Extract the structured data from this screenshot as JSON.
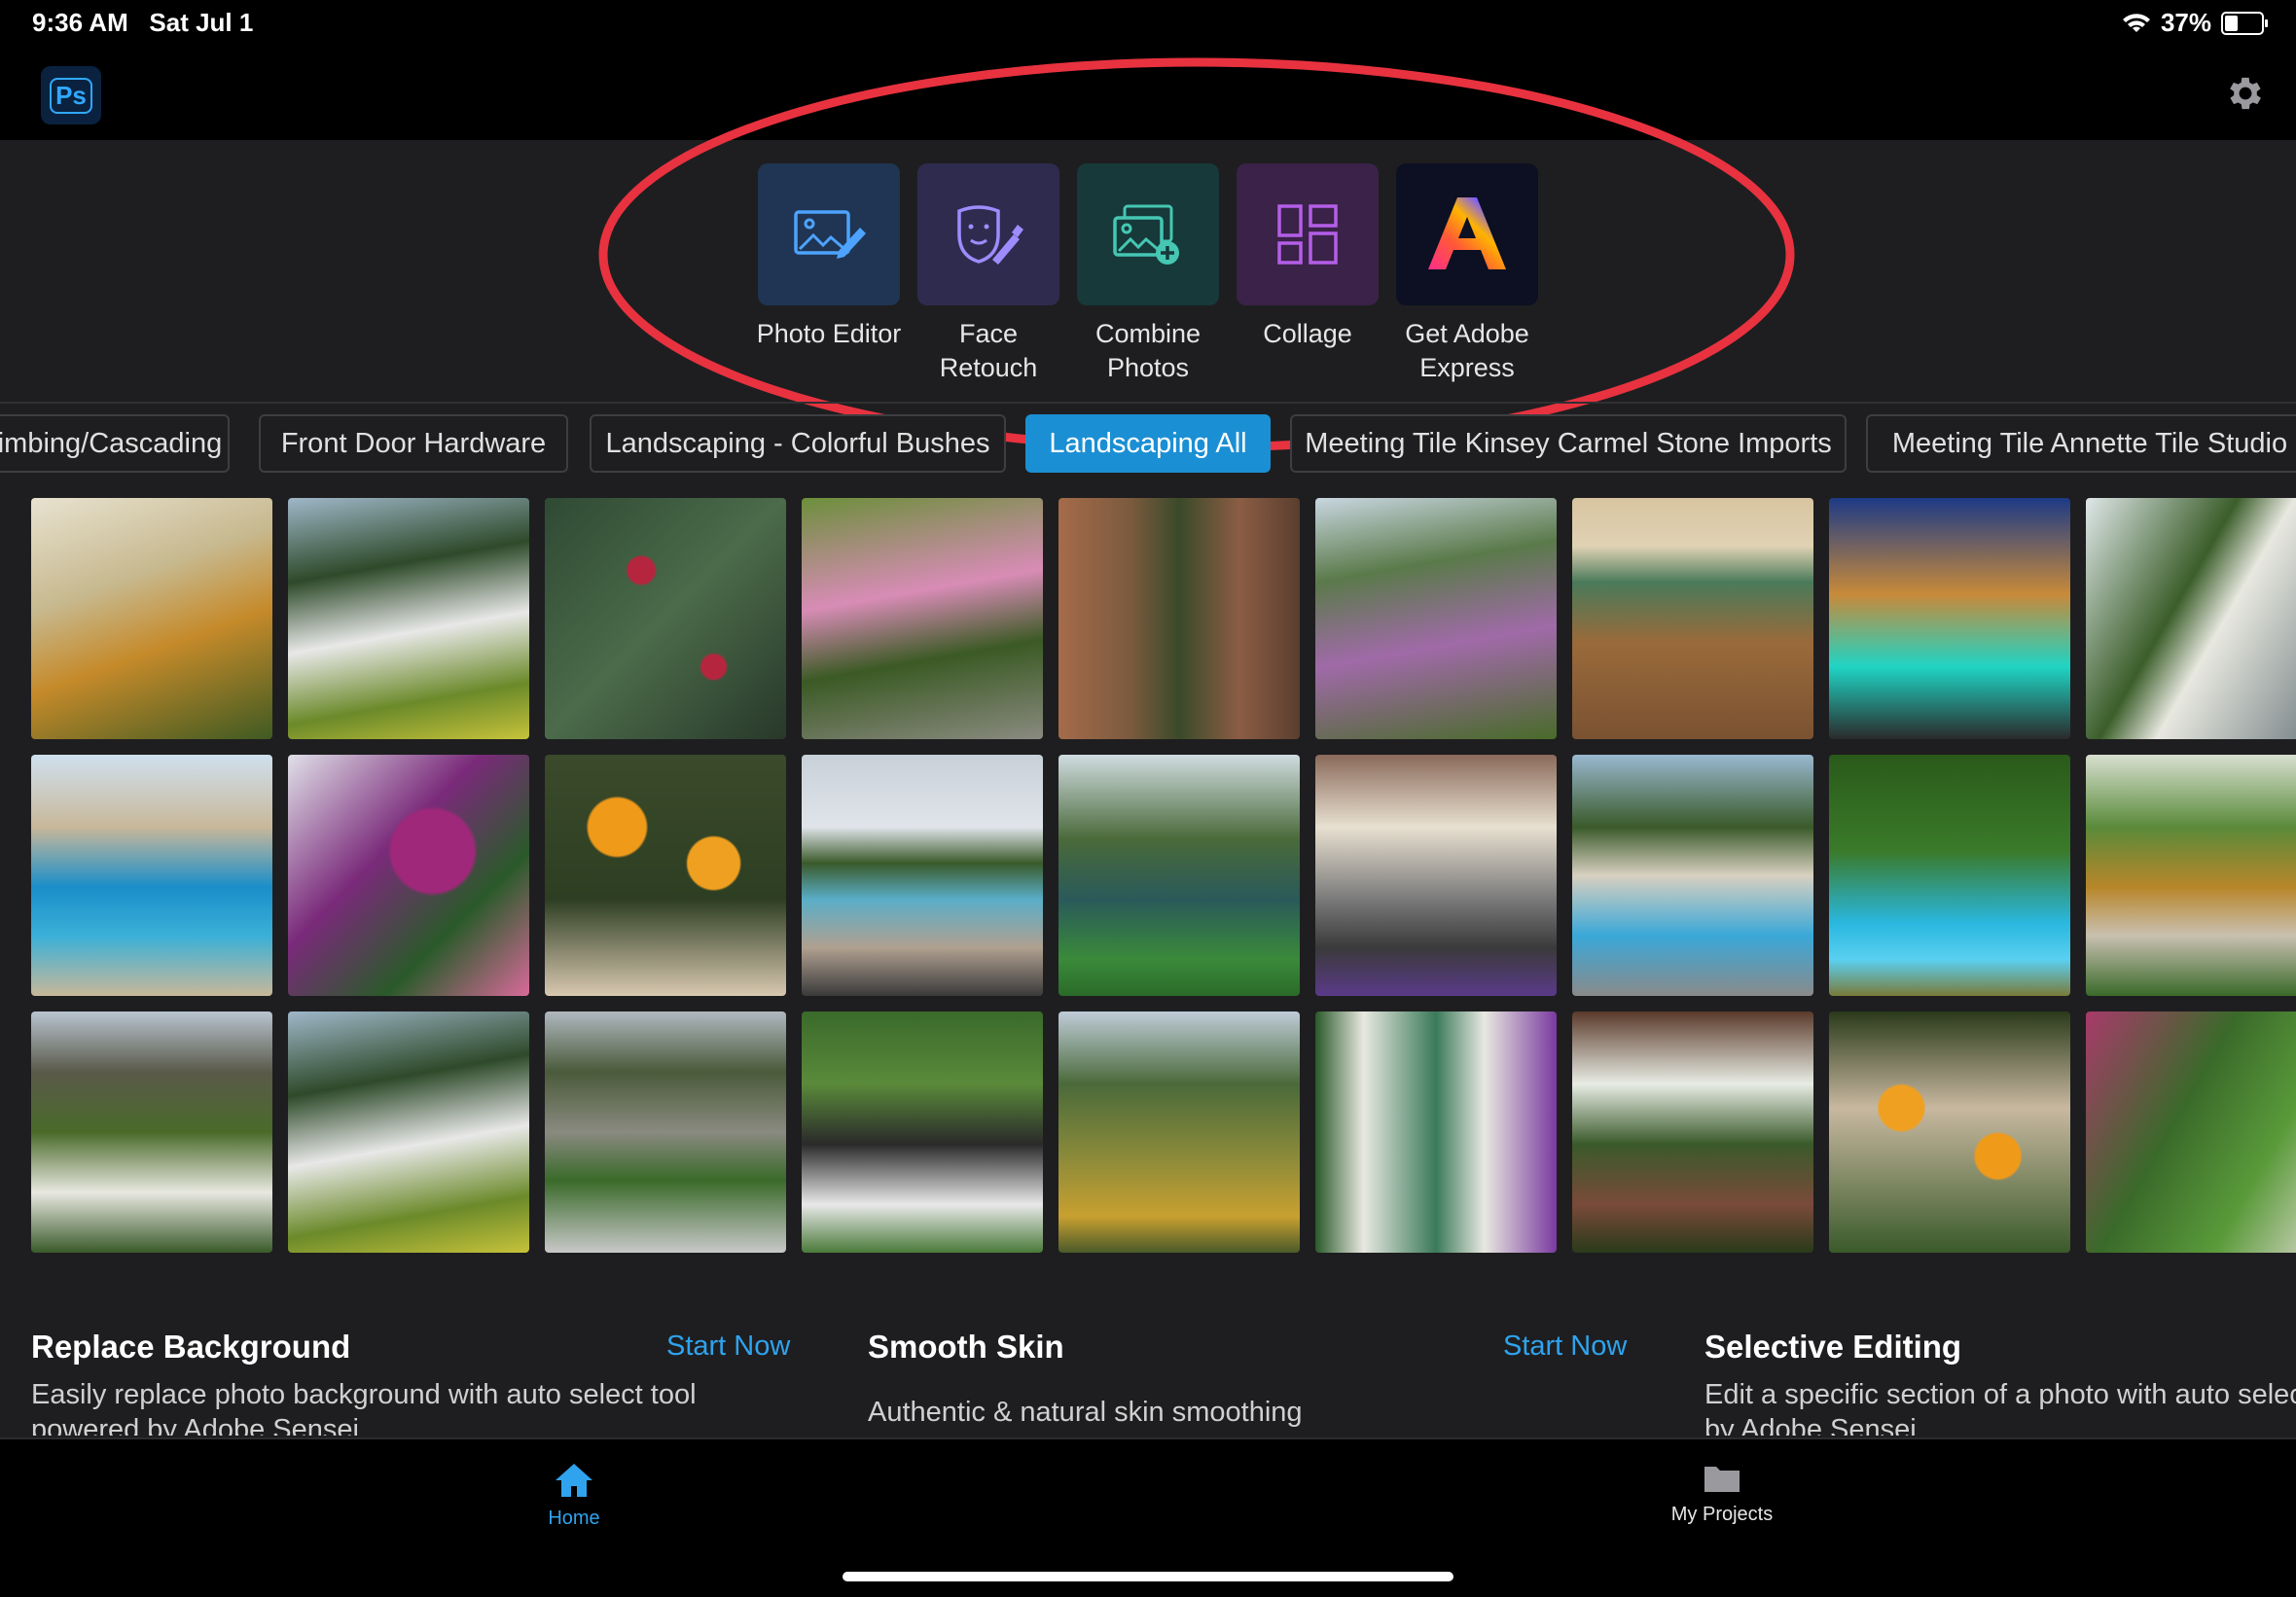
{
  "status_bar": {
    "time": "9:36 AM",
    "date": "Sat Jul 1",
    "battery": "37%",
    "wifi_icon": "wifi-icon"
  },
  "app": {
    "logo_text": "Ps",
    "settings_icon": "gear-icon"
  },
  "tools": [
    {
      "label": "Photo Editor",
      "icon": "photo-edit-icon",
      "bg": "#1f3553"
    },
    {
      "label": "Face\nRetouch",
      "icon": "face-retouch-icon",
      "bg": "#2f2b4f"
    },
    {
      "label": "Combine\nPhotos",
      "icon": "combine-photos-icon",
      "bg": "#17393a"
    },
    {
      "label": "Collage",
      "icon": "collage-icon",
      "bg": "#3a2248"
    },
    {
      "label": "Get Adobe\nExpress",
      "icon": "adobe-express-icon",
      "bg": "#0c1022"
    }
  ],
  "chips": [
    "imbing/Cascading",
    "Front Door Hardware",
    "Landscaping - Colorful Bushes",
    "Landscaping All",
    "Meeting Tile Kinsey Carmel Stone Imports",
    "Meeting Tile Annette Tile Studio"
  ],
  "active_chip": "Landscaping All",
  "cards": [
    {
      "title": "Replace Background",
      "link": "Start Now",
      "desc": "Easily replace photo background with auto select tool powered by Adobe Sensei"
    },
    {
      "title": "Smooth Skin",
      "link": "Start Now",
      "desc": "Authentic & natural skin smoothing"
    },
    {
      "title": "Selective Editing",
      "link": "",
      "desc": "Edit a specific section of a photo with auto select t by Adobe Sensei"
    }
  ],
  "nav": [
    {
      "label": "Home",
      "icon": "home-icon",
      "active": true
    },
    {
      "label": "My Projects",
      "icon": "folder-icon",
      "active": false
    }
  ],
  "colors": {
    "accent": "#1b8fd4",
    "highlight": "#e8323f",
    "link": "#2fa3ee"
  }
}
